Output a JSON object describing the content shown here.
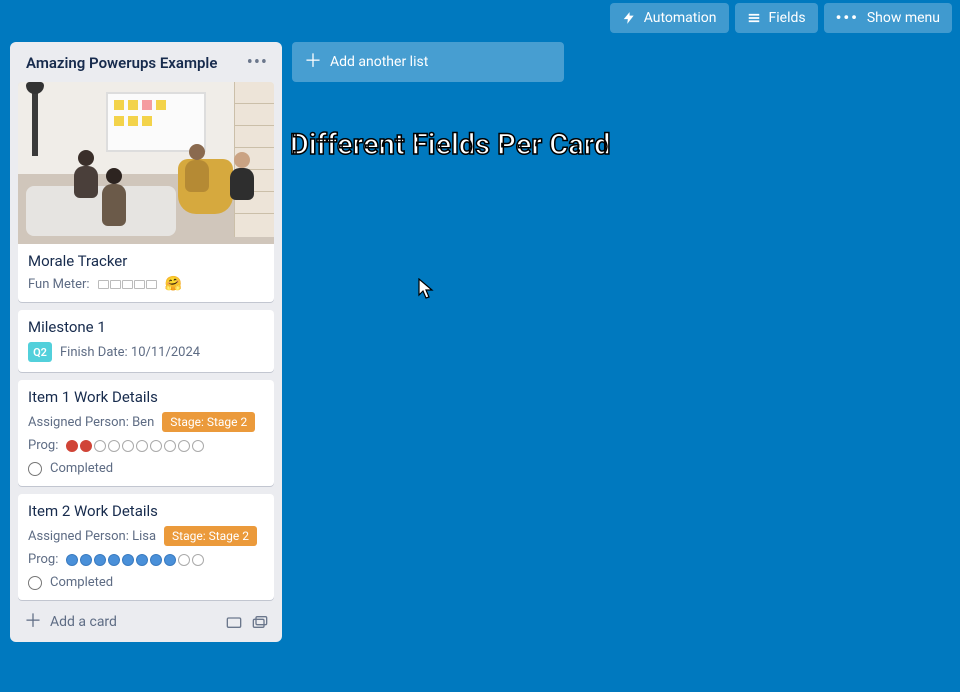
{
  "topbar": {
    "automation": "Automation",
    "fields": "Fields",
    "show_menu": "Show menu"
  },
  "overlay": "Different Fields Per Card",
  "list": {
    "title": "Amazing Powerups Example",
    "add_card": "Add a card"
  },
  "add_list_label": "Add another list",
  "cards": {
    "morale": {
      "title": "Morale Tracker",
      "fun_label": "Fun Meter:",
      "fun_emoji": "🤗"
    },
    "milestone": {
      "title": "Milestone 1",
      "q_badge": "Q2",
      "finish": "Finish Date: 10/11/2024"
    },
    "item1": {
      "title": "Item 1 Work Details",
      "assigned": "Assigned Person: Ben",
      "stage": "Stage: Stage 2",
      "prog_label": "Prog:",
      "prog_filled": 2,
      "prog_total": 10,
      "completed": "Completed"
    },
    "item2": {
      "title": "Item 2 Work Details",
      "assigned": "Assigned Person: Lisa",
      "stage": "Stage: Stage 2",
      "prog_label": "Prog:",
      "prog_filled": 8,
      "prog_total": 10,
      "completed": "Completed"
    }
  }
}
